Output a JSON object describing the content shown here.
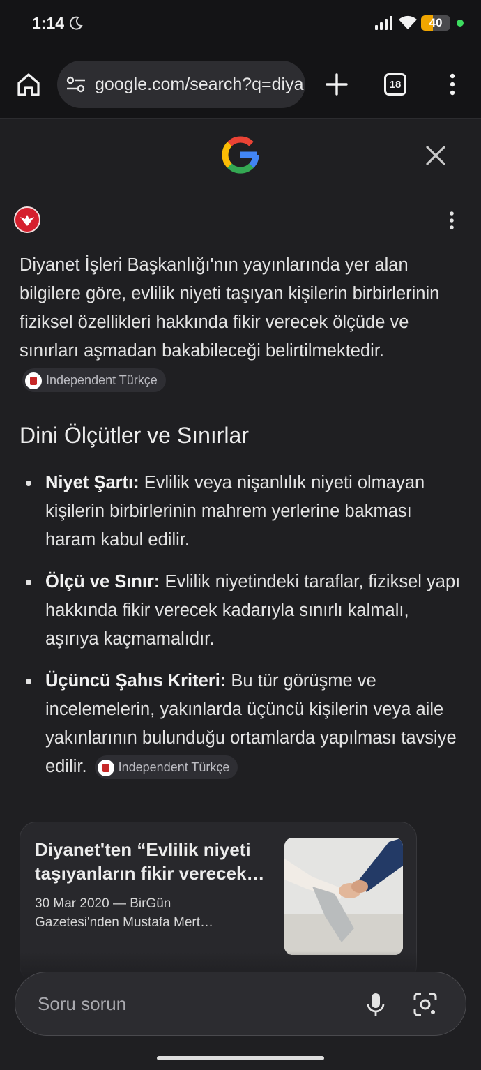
{
  "status_bar": {
    "time": "1:14",
    "battery": "40",
    "battery_level_percent": 40,
    "icons": [
      "moon-icon",
      "signal-icon",
      "wifi-icon",
      "battery-icon"
    ]
  },
  "browser": {
    "url": "google.com/search?q=diyanet",
    "tab_count": "18",
    "icons": [
      "home-icon",
      "tune-icon",
      "plus-icon",
      "tabs-icon",
      "menu-icon"
    ]
  },
  "ai_panel": {
    "paragraph": "Diyanet İşleri Başkanlığı'nın yayınlarında yer alan bilgilere göre, evlilik niyeti taşıyan kişilerin birbirlerinin fiziksel özellikleri hakkında fikir verecek ölçüde ve sınırları aşmadan bakabileceği belirtilmektedir.",
    "source_chip": "Independent Türkçe",
    "heading": "Dini Ölçütler ve Sınırlar",
    "bullets": [
      {
        "title": "Niyet Şartı:",
        "text": " Evlilik veya nişanlılık niyeti olmayan kişilerin birbirlerinin mahrem yerlerine bakması haram kabul edilir."
      },
      {
        "title": "Ölçü ve Sınır:",
        "text": " Evlilik niyetindeki taraflar, fiziksel yapı hakkında fikir verecek kadarıyla sınırlı kalmalı, aşırıya kaçmamalıdır."
      },
      {
        "title": "Üçüncü Şahıs Kriteri:",
        "text": " Bu tür görüşme ve incelemelerin, yakınlarda üçüncü kişilerin veya aile yakınlarının bulunduğu ortamlarda yapılması tavsiye edilir."
      }
    ],
    "bullet_source_chip": "Independent Türkçe"
  },
  "result_card": {
    "title": "Diyanet'ten “Evlilik niyeti taşıyanların fikir verecek…",
    "meta": "30 Mar 2020 — BirGün Gazetesi'nden Mustafa Mert…"
  },
  "ask_bar": {
    "placeholder": "Soru sorun"
  },
  "colors": {
    "background": "#1f1f22",
    "toolbar": "#141416",
    "battery_accent": "#f0a500",
    "dot_green": "#3ddc5f",
    "source_red": "#d5202e"
  }
}
